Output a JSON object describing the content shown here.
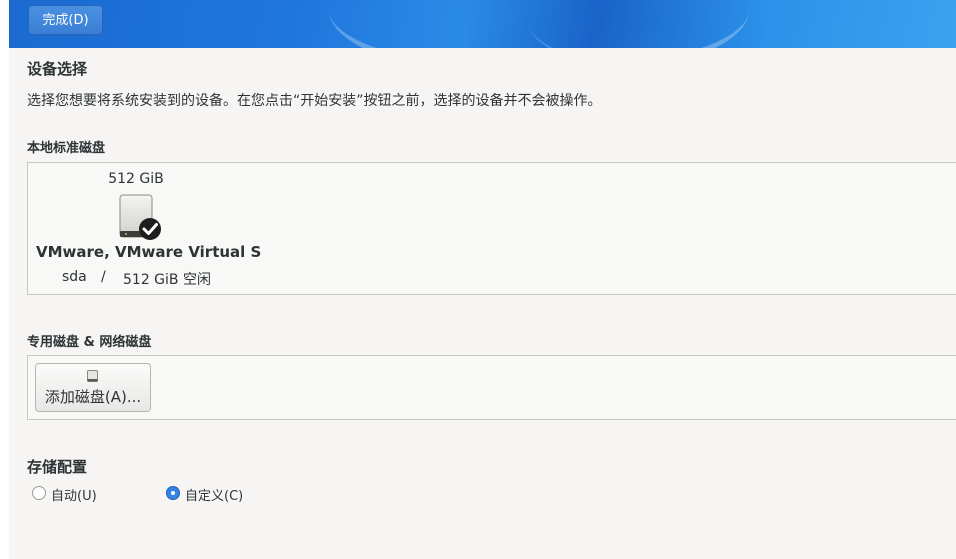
{
  "header": {
    "done_button": "完成(D)"
  },
  "device_selection": {
    "title": "设备选择",
    "description": "选择您想要将系统安装到的设备。在您点击“开始安装”按钮之前，选择的设备并不会被操作。"
  },
  "local_disks": {
    "title": "本地标准磁盘",
    "disks": [
      {
        "size": "512 GiB",
        "icon": "hard-disk-icon",
        "selected": true,
        "name": "VMware, VMware Virtual S",
        "device": "sda",
        "separator": "/",
        "free": "512 GiB 空闲"
      }
    ]
  },
  "special_disks": {
    "title": "专用磁盘 & 网络磁盘",
    "add_button": "添加磁盘(A)...",
    "add_icon": "disk-icon"
  },
  "storage_config": {
    "title": "存储配置",
    "options": [
      {
        "label": "自动(U)",
        "selected": false
      },
      {
        "label": "自定义(C)",
        "selected": true
      }
    ]
  },
  "colors": {
    "accent": "#3584e4",
    "header": "#1f76dc"
  }
}
